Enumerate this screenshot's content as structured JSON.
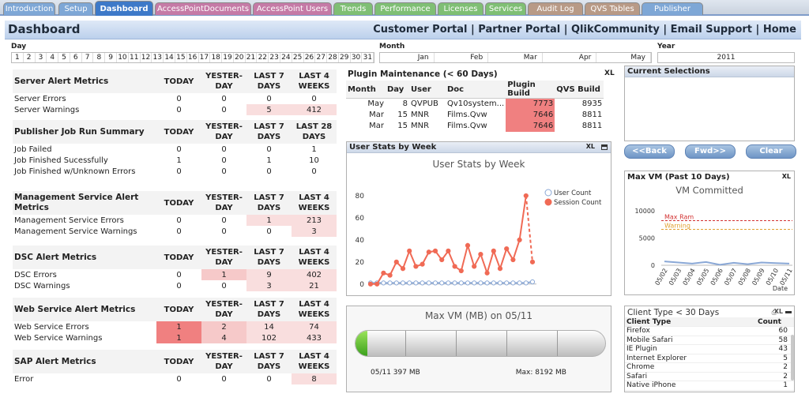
{
  "tabs": [
    {
      "label": "Introduction",
      "color": "#7ea7d6"
    },
    {
      "label": "Setup",
      "color": "#7ea7d6"
    },
    {
      "label": "Dashboard",
      "color": "#3d79c8",
      "active": true
    },
    {
      "label": "AccessPointDocuments",
      "color": "#c57aa6"
    },
    {
      "label": "AccessPoint Users",
      "color": "#c57aa6"
    },
    {
      "label": "Trends",
      "color": "#7fbf74"
    },
    {
      "label": "Performance",
      "color": "#7fbf74"
    },
    {
      "label": "Licenses",
      "color": "#7fbf74"
    },
    {
      "label": "Services",
      "color": "#7fbf74"
    },
    {
      "label": "Audit Log",
      "color": "#b89a86"
    },
    {
      "label": "QVS Tables",
      "color": "#b89a86"
    },
    {
      "label": "Publisher",
      "color": "#7ea7d6"
    }
  ],
  "header": {
    "title": "Dashboard",
    "links": "Customer Portal | Partner Portal | QlikCommunity | Email Support | Home"
  },
  "filters": {
    "day_label": "Day",
    "days": [
      "1",
      "2",
      "3",
      "4",
      "5",
      "6",
      "7",
      "8",
      "9",
      "10",
      "11",
      "12",
      "13",
      "14",
      "15",
      "16",
      "17",
      "18",
      "19",
      "20",
      "21",
      "22",
      "23",
      "24",
      "25",
      "26",
      "27",
      "28",
      "29",
      "30",
      "31"
    ],
    "month_label": "Month",
    "months": [
      "Jan",
      "Feb",
      "Mar",
      "Apr",
      "May"
    ],
    "year_label": "Year",
    "year": "2011"
  },
  "metrics": [
    {
      "title": "Server Alert Metrics",
      "cols": [
        "TODAY",
        "YESTER-\nDAY",
        "LAST 7\nDAYS",
        "LAST 4\nWEEKS"
      ],
      "rows": [
        {
          "name": "Server Errors",
          "vals": [
            "0",
            "0",
            "0",
            "0"
          ],
          "hl": [
            "",
            "",
            "",
            ""
          ]
        },
        {
          "name": "Server Warnings",
          "vals": [
            "0",
            "0",
            "5",
            "412"
          ],
          "hl": [
            "",
            "",
            "pink",
            "pink"
          ]
        }
      ]
    },
    {
      "title": "Publisher Job Run Summary",
      "cols": [
        "TODAY",
        "YESTER-\nDAY",
        "LAST 7\nDAYS",
        "LAST 28\nDAYS"
      ],
      "rows": [
        {
          "name": "Job Failed",
          "vals": [
            "0",
            "0",
            "0",
            "1"
          ],
          "hl": [
            "",
            "",
            "",
            ""
          ]
        },
        {
          "name": "Job Finished Sucessfully",
          "vals": [
            "1",
            "0",
            "1",
            "10"
          ],
          "hl": [
            "",
            "",
            "",
            ""
          ]
        },
        {
          "name": "Job Finished w/Unknown Errors",
          "vals": [
            "0",
            "0",
            "0",
            "0"
          ],
          "hl": [
            "",
            "",
            "",
            ""
          ]
        }
      ]
    },
    {
      "title": "Management Service Alert Metrics",
      "cols": [
        "TODAY",
        "YESTER-\nDAY",
        "LAST 7\nDAYS",
        "LAST 4\nWEEKS"
      ],
      "rows": [
        {
          "name": "Management Service Errors",
          "vals": [
            "0",
            "0",
            "1",
            "213"
          ],
          "hl": [
            "",
            "",
            "pink",
            "pink"
          ]
        },
        {
          "name": "Management Service Warnings",
          "vals": [
            "0",
            "0",
            "0",
            "3"
          ],
          "hl": [
            "",
            "",
            "",
            "pink"
          ]
        }
      ]
    },
    {
      "title": "DSC Alert Metrics",
      "cols": [
        "TODAY",
        "YESTER-\nDAY",
        "LAST 7\nDAYS",
        "LAST 4\nWEEKS"
      ],
      "rows": [
        {
          "name": "DSC Errors",
          "vals": [
            "0",
            "1",
            "9",
            "402"
          ],
          "hl": [
            "",
            "pink2",
            "pink",
            "pink"
          ]
        },
        {
          "name": "DSC Warnings",
          "vals": [
            "0",
            "0",
            "3",
            "21"
          ],
          "hl": [
            "",
            "",
            "pink",
            "pink"
          ]
        }
      ]
    },
    {
      "title": "Web Service Alert Metrics",
      "cols": [
        "TODAY",
        "YESTER-\nDAY",
        "LAST 7\nDAYS",
        "LAST 4\nWEEKS"
      ],
      "rows": [
        {
          "name": "Web Service Errors",
          "vals": [
            "1",
            "2",
            "14",
            "74"
          ],
          "hl": [
            "red",
            "pink2",
            "pink",
            "pink"
          ]
        },
        {
          "name": "Web Service Warnings",
          "vals": [
            "1",
            "4",
            "102",
            "433"
          ],
          "hl": [
            "red",
            "pink2",
            "pink",
            "pink"
          ]
        }
      ]
    },
    {
      "title": "SAP Alert Metrics",
      "cols": [
        "TODAY",
        "YESTER-\nDAY",
        "LAST 7\nDAYS",
        "LAST 4\nWEEKS"
      ],
      "rows": [
        {
          "name": "Error",
          "vals": [
            "0",
            "0",
            "0",
            "8"
          ],
          "hl": [
            "",
            "",
            "",
            "pink"
          ]
        }
      ]
    }
  ],
  "plugin": {
    "title": "Plugin Maintenance (< 60 Days)",
    "xl": "XL",
    "cols": [
      "Month",
      "Day",
      "User",
      "Doc",
      "Plugin Build",
      "QVS Build"
    ],
    "rows": [
      [
        "May",
        "8",
        "QVPUB",
        "Qv10system...",
        "7773",
        "8935"
      ],
      [
        "Mar",
        "15",
        "MNR",
        "Films.Qvw",
        "7646",
        "8811"
      ],
      [
        "Mar",
        "15",
        "MNR",
        "Films.Qvw",
        "7646",
        "8811"
      ]
    ]
  },
  "userstats": {
    "caption": "User Stats by Week",
    "xl": "XL"
  },
  "maxvm": {
    "title": "Max VM (MB) on 05/11",
    "left": "05/11  397 MB",
    "right": "Max: 8192 MB"
  },
  "selections": {
    "title": "Current Selections",
    "back": "<<Back",
    "fwd": "Fwd>>",
    "clear": "Clear"
  },
  "vmbox": {
    "caption": "Max VM  (Past 10 Days)",
    "xl": "XL"
  },
  "client": {
    "caption": "Client Type < 30 Days",
    "col1": "Client Type",
    "col2": "Count",
    "rows": [
      [
        "Firefox",
        "60"
      ],
      [
        "Mobile Safari",
        "58"
      ],
      [
        "IE Plugin",
        "43"
      ],
      [
        "Internet Explorer",
        "5"
      ],
      [
        "Chrome",
        "2"
      ],
      [
        "Safari",
        "2"
      ],
      [
        "Native iPhone",
        "1"
      ]
    ]
  },
  "chart_data": [
    {
      "type": "line",
      "title": "User Stats by Week",
      "legend": "top-right",
      "x": [
        1,
        2,
        3,
        4,
        5,
        6,
        7,
        8,
        9,
        10,
        11,
        12,
        13,
        14,
        15,
        16,
        17,
        18,
        19,
        20,
        21,
        22,
        23,
        24,
        25,
        26
      ],
      "ylim": [
        -3,
        90
      ],
      "yticks": [
        0,
        20,
        40,
        60,
        80
      ],
      "series": [
        {
          "name": "User Count",
          "color": "#8aa8d6",
          "values": [
            1,
            1,
            1,
            1,
            1,
            1,
            1,
            1,
            1,
            1,
            1,
            1,
            1,
            1,
            1,
            1,
            1,
            1,
            1,
            1,
            1,
            1,
            1,
            1,
            1,
            2
          ]
        },
        {
          "name": "Session Count",
          "color": "#f06a55",
          "values": [
            0,
            0,
            10,
            8,
            20,
            14,
            30,
            16,
            18,
            29,
            30,
            22,
            30,
            16,
            12,
            35,
            16,
            27,
            10,
            30,
            14,
            32,
            22,
            40,
            80,
            20
          ]
        }
      ]
    },
    {
      "type": "line",
      "title": "VM Committed",
      "x": [
        "05/02",
        "05/03",
        "05/04",
        "05/05",
        "05/06",
        "05/07",
        "05/08",
        "05/09",
        "05/10",
        "05/11"
      ],
      "xlabel": "Date",
      "ylim": [
        0,
        10000
      ],
      "yticks": [
        0,
        5000,
        10000
      ],
      "series": [
        {
          "name": "VM Committed",
          "color": "#8aa8d6",
          "values": [
            700,
            500,
            300,
            600,
            100,
            450,
            200,
            500,
            400,
            300
          ]
        }
      ],
      "reference_lines": [
        {
          "name": "Max Ram",
          "value": 8192,
          "color": "#d23030"
        },
        {
          "name": "Warning",
          "value": 6600,
          "color": "#e0a030"
        }
      ]
    }
  ]
}
